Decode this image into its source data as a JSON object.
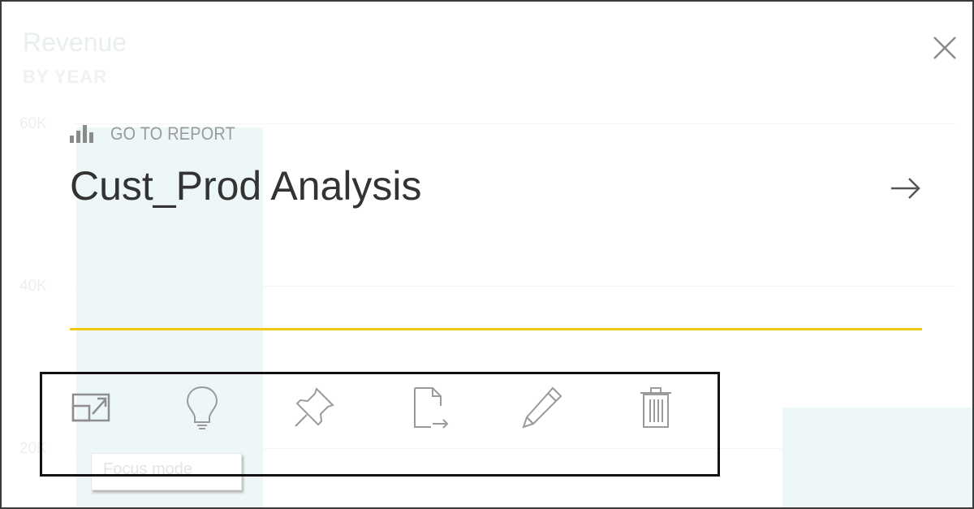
{
  "background_tile": {
    "title": "Revenue",
    "subtitle": "BY YEAR",
    "ticks": [
      "60K",
      "40K",
      "20K"
    ],
    "tooltip": "Focus mode"
  },
  "overlay": {
    "go_to_report_label": "GO TO REPORT",
    "report_title": "Cust_Prod Analysis"
  },
  "toolbar": {
    "items": [
      {
        "icon": "focus-mode-icon"
      },
      {
        "icon": "lightbulb-icon"
      },
      {
        "icon": "pin-icon"
      },
      {
        "icon": "export-icon"
      },
      {
        "icon": "pencil-icon"
      },
      {
        "icon": "trash-icon"
      }
    ]
  },
  "colors": {
    "accent_line": "#f2c811",
    "title_text": "#333333",
    "icon_gray": "#9a9a9a",
    "highlight_box": "#111111",
    "faded_bar": "#eef7f8"
  }
}
